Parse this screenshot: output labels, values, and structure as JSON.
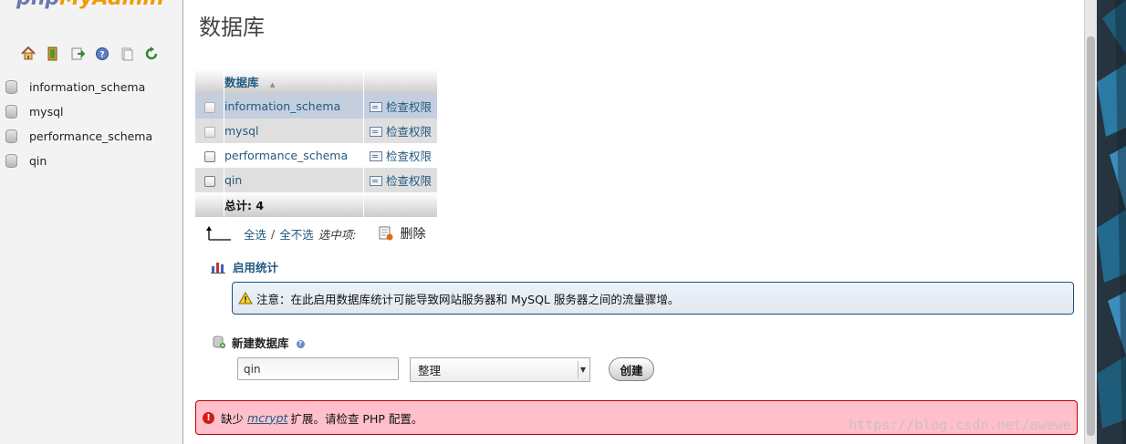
{
  "nav": {
    "logo_php": "php",
    "logo_myadmin": "MyAdmin",
    "icons": [
      "home-icon",
      "logout-icon",
      "query-window-icon",
      "help-icon",
      "docs-icon",
      "reload-icon"
    ],
    "databases": [
      "information_schema",
      "mysql",
      "performance_schema",
      "qin"
    ]
  },
  "main": {
    "title": "数据库",
    "table": {
      "header": "数据库",
      "rows": [
        {
          "name": "information_schema",
          "action": "检查权限"
        },
        {
          "name": "mysql",
          "action": "检查权限"
        },
        {
          "name": "performance_schema",
          "action": "检查权限"
        },
        {
          "name": "qin",
          "action": "检查权限"
        }
      ],
      "total": "总计: 4"
    },
    "select_all": "全选",
    "separator": "/",
    "select_none": "全不选",
    "with_selected": "选中项:",
    "delete": "删除",
    "enable_stats": "启用统计",
    "notice": "注意：在此启用数据库统计可能导致网站服务器和 MySQL 服务器之间的流量骤增。",
    "create_db_title": "新建数据库",
    "new_db_value": "qin",
    "collation": "整理",
    "create_button": "创建",
    "error_prefix": "缺少",
    "error_ext": "mcrypt",
    "error_suffix": "扩展。请检查 PHP 配置。"
  },
  "watermark": "https://blog.csdn.net/awewe"
}
